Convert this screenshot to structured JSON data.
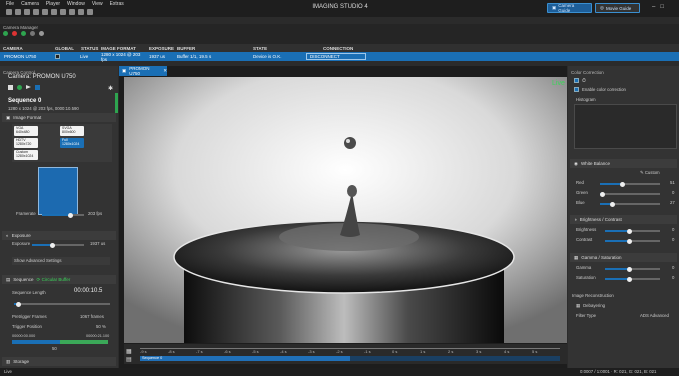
{
  "app": {
    "title": "IMAGING STUDIO 4",
    "menus": [
      "File",
      "Camera",
      "Player",
      "Window",
      "View",
      "Extras"
    ],
    "camera_guide": "Camera Guide",
    "movie_guide": "Movie Guide"
  },
  "camera_manager": {
    "title": "Camera Manager",
    "columns": [
      "CAMERA",
      "GLOBAL",
      "STATUS",
      "IMAGE FORMAT",
      "EXPOSURE",
      "BUFFER",
      "STATE",
      "CONNECTION"
    ],
    "row": {
      "camera": "PROMON U750",
      "status": "Live",
      "image_format": "1280 x 1024 @ 203 fps",
      "exposure": "1937 us",
      "buffer": "Buffer 1/1, 19.5 s",
      "state": "Device is O.K.",
      "connection": "DISCONNECT"
    }
  },
  "left": {
    "title": "Camera Control",
    "camera_label": "Camera:",
    "camera_name": "PROMON U750",
    "sequence_name": "Sequence 0",
    "sequence_info": "1280 x 1024 @ 203 fps, 0000:10.590",
    "image_format_title": "Image Format",
    "formats": [
      {
        "name": "VGA",
        "res": "640x480"
      },
      {
        "name": "SVGA",
        "res": "800x600"
      },
      {
        "name": "HDTV",
        "res": "1280x720"
      },
      {
        "name": "Full",
        "res": "1280x1024"
      },
      {
        "name": "Custom",
        "res": "1280x1024"
      }
    ],
    "frame_rate_label": "Framerate",
    "frame_rate_value": "203 fps",
    "exposure_title": "Exposure",
    "exposure_label": "Exposure",
    "exposure_value": "1937 us",
    "advanced_settings": "Show Advanced Settings",
    "sequence_title": "Sequence",
    "buffer_mode": "Circular Buffer",
    "sequence_length_label": "Sequence Length",
    "sequence_length_value": "00:00:10.5",
    "pretrigger_label": "Pretrigger Frames",
    "pretrigger_value": "1067 frames",
    "trigger_position_label": "Trigger Position",
    "trigger_position_value": "50 %",
    "range_start": "00000:00.000",
    "range_end": "00000:21.100",
    "range_mid": "50",
    "storage_title": "Storage"
  },
  "video": {
    "tab": "PROMON U750",
    "live_label": "Live",
    "sequence_label": "Sequence 0",
    "ticks": [
      "-9 s",
      "-8 s",
      "-7 s",
      "-6 s",
      "-5 s",
      "-4 s",
      "-3 s",
      "-2 s",
      "-1 s",
      "0 s",
      "1 s",
      "2 s",
      "3 s",
      "4 s",
      "5 s"
    ]
  },
  "right": {
    "title": "Color Correction",
    "enable_label": "Enable color correction",
    "histogram_title": "Histogram",
    "histogram_mode": "Logarithmic",
    "histogram_color": "Gray",
    "wb_title": "White Balance",
    "wb_mode": "Custom",
    "wb": [
      {
        "label": "Red",
        "value": "51"
      },
      {
        "label": "Green",
        "value": "0"
      },
      {
        "label": "Blue",
        "value": "27"
      }
    ],
    "bc_title": "Brightness / Contrast",
    "bc": [
      {
        "label": "Brightness",
        "value": "0"
      },
      {
        "label": "Contrast",
        "value": "0"
      }
    ],
    "gs_title": "Gamma / Saturation",
    "gs": [
      {
        "label": "Gamma",
        "value": "0"
      },
      {
        "label": "Saturation",
        "value": "0"
      }
    ],
    "recon_title": "Image Reconstruction",
    "debayering": "Debayering",
    "filter_label": "Filter Type",
    "filter_value": "ADS Advanced"
  },
  "status": {
    "left": "Live",
    "right": "0:0007 / 1:0001 · R: 021, G: 021, B: 021"
  },
  "colors": {
    "accent": "#1a6fb5",
    "live": "#3bd45a"
  }
}
